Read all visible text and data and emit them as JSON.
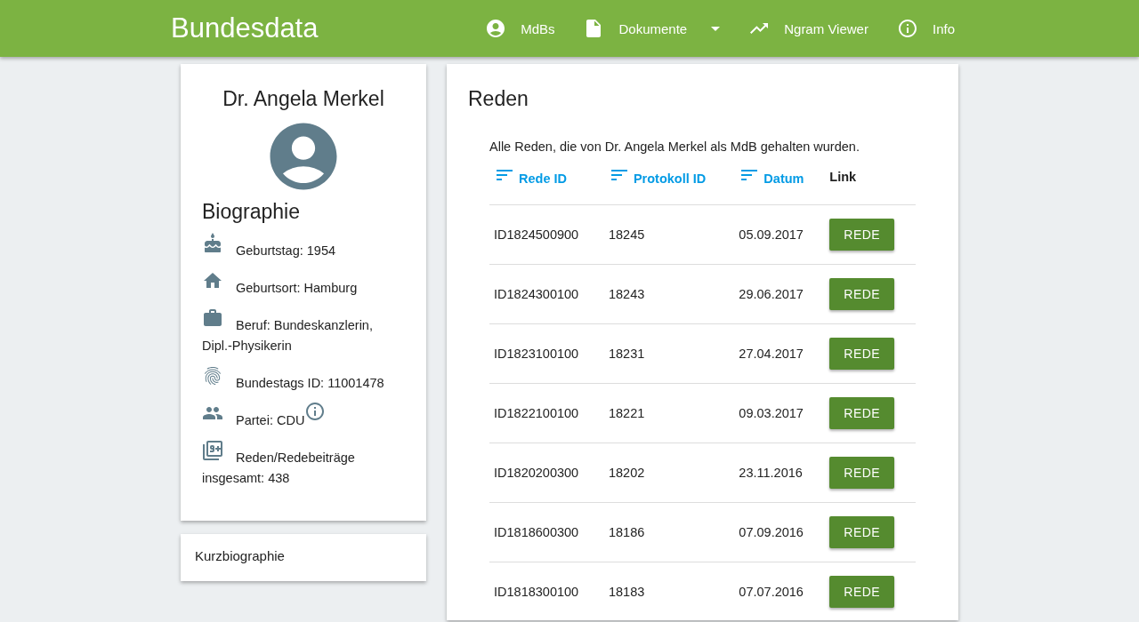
{
  "brand": "Bundesdata",
  "nav": [
    {
      "kind": "person",
      "label": "MdBs",
      "dropdown": false
    },
    {
      "kind": "document",
      "label": "Dokumente",
      "dropdown": true
    },
    {
      "kind": "trend",
      "label": "Ngram Viewer",
      "dropdown": false
    },
    {
      "kind": "info",
      "label": "Info",
      "dropdown": false
    }
  ],
  "profile": {
    "name": "Dr. Angela Merkel",
    "section_title": "Biographie",
    "items": [
      {
        "kind": "birthday",
        "text": "Geburtstag: 1954"
      },
      {
        "kind": "home",
        "text": "Geburtsort: Hamburg"
      },
      {
        "kind": "work",
        "text": "Beruf: Bundeskanzlerin, Dipl.-Physikerin"
      },
      {
        "kind": "id",
        "text": "Bundestags ID: 11001478"
      },
      {
        "kind": "party",
        "text": "Partei: CDU"
      },
      {
        "kind": "count",
        "text": "Reden/Redebeiträge insgesamt: 438"
      }
    ]
  },
  "short_bio": {
    "title": "Kurzbiographie"
  },
  "speeches": {
    "title": "Reden",
    "description": "Alle Reden, die von Dr. Angela Merkel als MdB gehalten wurden.",
    "columns": [
      {
        "label": "Rede ID",
        "sortable": true
      },
      {
        "label": "Protokoll ID",
        "sortable": true
      },
      {
        "label": "Datum",
        "sortable": true
      },
      {
        "label": "Link",
        "sortable": false
      }
    ],
    "rows": [
      [
        "ID1824500900",
        "18245",
        "05.09.2017",
        "REDE"
      ],
      [
        "ID1824300100",
        "18243",
        "29.06.2017",
        "REDE"
      ],
      [
        "ID1823100100",
        "18231",
        "27.04.2017",
        "REDE"
      ],
      [
        "ID1822100100",
        "18221",
        "09.03.2017",
        "REDE"
      ],
      [
        "ID1820200300",
        "18202",
        "23.11.2016",
        "REDE"
      ],
      [
        "ID1818600300",
        "18186",
        "07.09.2016",
        "REDE"
      ],
      [
        "ID1818300100",
        "18183",
        "07.07.2016",
        "REDE"
      ]
    ]
  }
}
